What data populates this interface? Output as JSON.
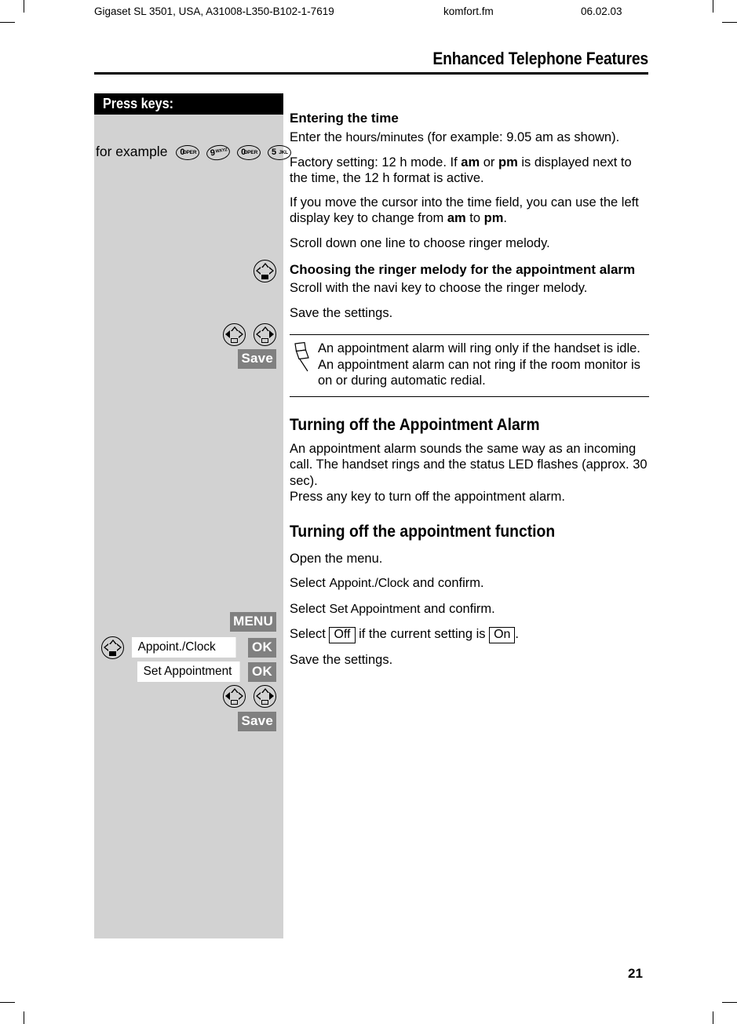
{
  "page": {
    "number": "21",
    "running_head": {
      "doc_id": "Gigaset SL 3501, USA, A31008-L350-B102-1-7619",
      "file_name": "komfort.fm",
      "date": "06.02.03"
    },
    "chapter_title": "Enhanced Telephone Features"
  },
  "left_column": {
    "header": "Press keys:",
    "for_example_label": "for example",
    "keypad_keys": [
      {
        "digit": "0",
        "letters": "OPER"
      },
      {
        "digit": "9",
        "letters": "WXYZ"
      },
      {
        "digit": "0",
        "letters": "OPER"
      },
      {
        "digit": "5",
        "letters": "JKL"
      }
    ],
    "softkeys": {
      "save": "Save",
      "menu": "MENU",
      "ok": "OK",
      "save2": "Save"
    },
    "menu_entries": [
      {
        "label": "Appoint./Clock",
        "confirm": "OK"
      },
      {
        "label": "Set Appointment",
        "confirm": "OK"
      }
    ]
  },
  "right_column": {
    "heading_entering_time": "Entering the time",
    "para_enter_hours_a": "Enter the ",
    "para_enter_hours_b": "hours/minutes",
    "para_enter_hours_c": " (for example: 9.05 am as shown).",
    "para_factory_a": "Factory setting: 12 h mode. If ",
    "para_factory_am": "am",
    "para_factory_b": " or ",
    "para_factory_pm": "pm",
    "para_factory_c": " is displayed next to the time, the 12 h format is active.",
    "para_cursor_a": "If you move the cursor into the time field, you can use the left display key to change from ",
    "para_cursor_am": "am",
    "para_cursor_b": " to ",
    "para_cursor_pm": "pm",
    "para_cursor_c": ".",
    "para_scroll_down": "Scroll down one line to choose ringer melody.",
    "heading_choosing_melody": "Choosing the ringer melody for the appointment alarm",
    "para_scroll_navi": "Scroll with the navi key to choose the ringer melody.",
    "para_save_settings": "Save the settings.",
    "note": "An appointment alarm will ring only if the handset is idle. An appointment alarm can not ring if the room monitor is on or during automatic redial.",
    "heading_turning_off_alarm": "Turning off the Appointment Alarm",
    "para_alarm_sounds": "An appointment alarm sounds the same way as an incoming call. The handset rings and the status LED flashes (approx. 30 sec).",
    "para_press_any_key": "Press any key to turn off the appointment alarm.",
    "heading_turning_off_function": "Turning off the appointment function",
    "para_open_menu": "Open the menu.",
    "para_select_clock_a": "Select ",
    "para_select_clock_b": "Appoint./Clock",
    "para_select_clock_c": " and confirm.",
    "para_select_appt_a": "Select ",
    "para_select_appt_b": "Set Appointment",
    "para_select_appt_c": " and confirm.",
    "para_select_off_a": "Select ",
    "para_select_off_b": "Off",
    "para_select_off_c": " if the current setting is ",
    "para_select_off_d": "On",
    "para_select_off_e": ".",
    "para_save_settings2": "Save the settings."
  },
  "icons": {
    "navi_down": "navi-key-down-icon",
    "navi_left": "navi-key-left-icon",
    "navi_right": "navi-key-right-icon",
    "pin": "push-pin-icon"
  },
  "colors": {
    "panel_gray": "#d2d2d2",
    "softkey_gray": "#808080",
    "header_black": "#000000"
  }
}
